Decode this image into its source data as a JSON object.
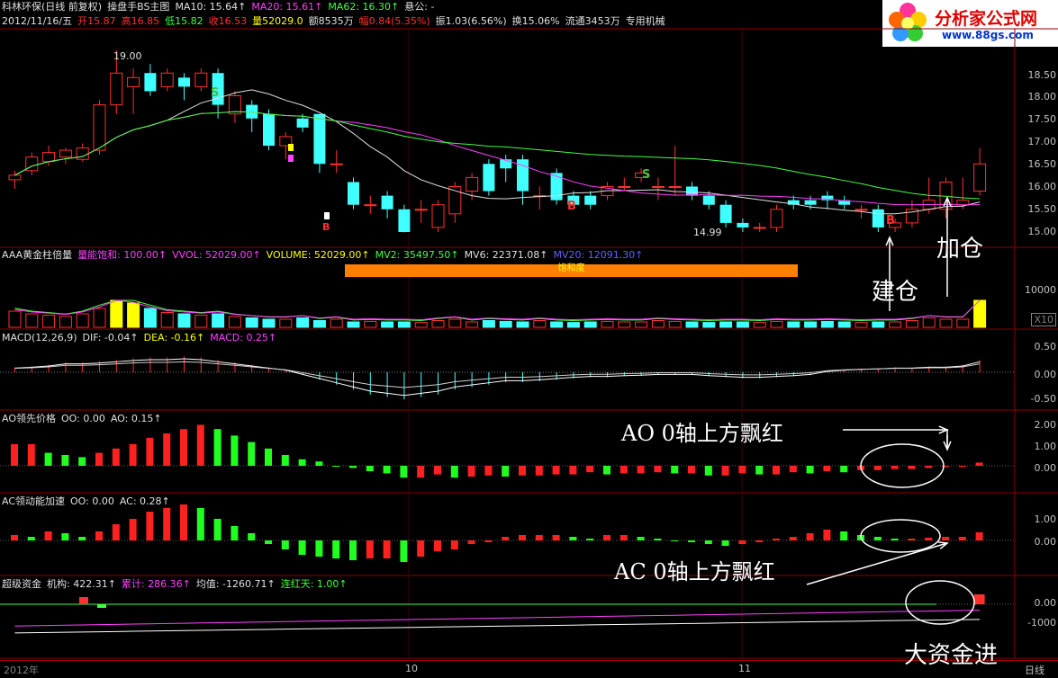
{
  "title_bar": {
    "stock": "科林环保(日线 前复权)",
    "indicator": "操盘手BS主图",
    "ma10": "MA10: 15.64↑",
    "ma20": "MA20: 15.61↑",
    "ma62": "MA62: 16.30↑",
    "flag": "悬公: -"
  },
  "quote_bar": {
    "date": "2012/11/16/五",
    "open": "开15.87",
    "high": "高16.85",
    "low": "低15.82",
    "close": "收16.53",
    "vol": "量52029.0",
    "amount": "额8535万",
    "change": "幅0.84(5.35%)",
    "amplitude": "振1.03(6.56%)",
    "turnover": "换15.06%",
    "float": "流通3453万",
    "industry": "专用机械"
  },
  "logo": {
    "text": "分析家公式网",
    "url": "www.88gs.com"
  },
  "price_axis": [
    "18.50",
    "18.00",
    "17.50",
    "17.00",
    "16.50",
    "16.00",
    "15.50",
    "15.00"
  ],
  "price_labels": {
    "high": "19.00",
    "low": "14.99",
    "s1": "S",
    "s2": "S",
    "b1": "B",
    "b2": "B",
    "b3": "B"
  },
  "vol_panel": {
    "name": "AAA黄金柱倍量",
    "sat": "量能饱和: 100.00↑",
    "vvol": "VVOL: 52029.00↑",
    "volume": "VOLUME: 52029.00↑",
    "mv2": "MV2: 35497.50↑",
    "mv6": "MV6: 22371.08↑",
    "mv20": "MV20: 12091.30↑",
    "bar_label": "饱和度",
    "axis": "10000",
    "unit": "X10"
  },
  "macd_panel": {
    "name": "MACD(12,26,9)",
    "dif": "DIF: -0.04↑",
    "dea": "DEA: -0.16↑",
    "macd": "MACD: 0.25↑",
    "axis": [
      "0.50",
      "0.00",
      "-0.50"
    ]
  },
  "ao_panel": {
    "name": "AO领先价格",
    "oo": "OO: 0.00",
    "ao": "AO: 0.15↑",
    "axis": [
      "2.00",
      "1.00",
      "0.00"
    ]
  },
  "ac_panel": {
    "name": "AC领动能加速",
    "oo": "OO: 0.00",
    "ac": "AC: 0.28↑",
    "axis": [
      "1.00",
      "0.00"
    ]
  },
  "fund_panel": {
    "name": "超级资金",
    "inst": "机构: 422.31↑",
    "cum": "累计: 286.36↑",
    "avg": "均值: -1260.71↑",
    "red": "连红天: 1.00↑",
    "axis": [
      "0.00",
      "-1000"
    ]
  },
  "time_axis": {
    "y": "2012年",
    "m10": "10",
    "m11": "11",
    "period": "日线"
  },
  "annotations": {
    "jiancang": "建仓",
    "jiacang": "加仓",
    "ao_note": "AO 0轴上方飘红",
    "ac_note": "AC 0轴上方飘红",
    "big_money": "大资金进"
  },
  "colors": {
    "up": "#ff3030",
    "down": "#40ffff",
    "green": "#40ff40",
    "magenta": "#ff40ff",
    "orange": "#ff8000"
  },
  "candles": [
    [
      16.15,
      16.25,
      15.95,
      16.35
    ],
    [
      16.35,
      16.65,
      16.25,
      16.75
    ],
    [
      16.55,
      16.75,
      16.45,
      16.9
    ],
    [
      16.65,
      16.8,
      16.5,
      16.85
    ],
    [
      16.6,
      16.85,
      16.55,
      16.95
    ],
    [
      16.8,
      17.8,
      16.7,
      17.9
    ],
    [
      17.8,
      18.5,
      17.6,
      19.0
    ],
    [
      18.2,
      18.4,
      17.6,
      18.6
    ],
    [
      18.5,
      18.1,
      18.0,
      18.7
    ],
    [
      18.2,
      18.5,
      18.1,
      18.6
    ],
    [
      18.4,
      18.2,
      17.9,
      18.5
    ],
    [
      18.2,
      18.5,
      18.1,
      18.6
    ],
    [
      18.5,
      17.8,
      17.5,
      18.6
    ],
    [
      17.6,
      18.0,
      17.4,
      18.1
    ],
    [
      17.8,
      17.5,
      17.2,
      17.9
    ],
    [
      17.6,
      16.9,
      16.8,
      17.7
    ],
    [
      16.9,
      17.1,
      16.6,
      17.2
    ],
    [
      17.5,
      17.3,
      17.2,
      17.6
    ],
    [
      17.6,
      16.5,
      16.3,
      17.6
    ],
    [
      16.5,
      16.5,
      16.3,
      16.8
    ],
    [
      16.1,
      15.6,
      15.5,
      16.2
    ],
    [
      15.6,
      15.6,
      15.4,
      15.8
    ],
    [
      15.8,
      15.5,
      15.3,
      15.9
    ],
    [
      15.5,
      15.0,
      14.99,
      15.6
    ],
    [
      15.5,
      15.5,
      15.2,
      15.7
    ],
    [
      15.1,
      15.6,
      15.0,
      15.7
    ],
    [
      15.4,
      16.0,
      15.2,
      16.1
    ],
    [
      15.9,
      16.2,
      15.7,
      16.3
    ],
    [
      16.5,
      15.9,
      15.8,
      16.6
    ],
    [
      16.6,
      16.4,
      16.1,
      16.7
    ],
    [
      16.6,
      15.9,
      15.6,
      16.7
    ],
    [
      15.8,
      15.8,
      15.5,
      16.0
    ],
    [
      16.3,
      15.7,
      15.6,
      16.4
    ],
    [
      15.8,
      15.6,
      15.5,
      15.9
    ],
    [
      15.8,
      15.6,
      15.5,
      15.9
    ],
    [
      15.8,
      16.0,
      15.7,
      16.1
    ],
    [
      16.0,
      16.0,
      15.9,
      16.2
    ],
    [
      16.2,
      16.3,
      16.1,
      16.4
    ],
    [
      16.0,
      16.0,
      15.7,
      16.2
    ],
    [
      16.0,
      16.0,
      15.8,
      16.9
    ],
    [
      16.0,
      15.8,
      15.7,
      16.1
    ],
    [
      15.8,
      15.6,
      15.5,
      15.9
    ],
    [
      15.6,
      15.2,
      15.1,
      15.7
    ],
    [
      15.2,
      15.1,
      15.0,
      15.3
    ],
    [
      15.1,
      15.1,
      15.0,
      15.2
    ],
    [
      15.1,
      15.5,
      15.0,
      15.6
    ],
    [
      15.7,
      15.6,
      15.5,
      15.8
    ],
    [
      15.7,
      15.6,
      15.5,
      15.8
    ],
    [
      15.8,
      15.7,
      15.5,
      15.9
    ],
    [
      15.7,
      15.6,
      15.5,
      15.8
    ],
    [
      15.5,
      15.5,
      15.3,
      15.6
    ],
    [
      15.5,
      15.1,
      15.0,
      15.6
    ],
    [
      15.1,
      15.2,
      15.0,
      15.3
    ],
    [
      15.2,
      15.5,
      15.1,
      15.7
    ],
    [
      15.5,
      15.7,
      15.4,
      16.2
    ],
    [
      15.5,
      16.1,
      15.3,
      16.2
    ],
    [
      15.6,
      15.7,
      15.5,
      16.2
    ],
    [
      15.9,
      16.5,
      15.8,
      16.85
    ]
  ],
  "ao_values": [
    1.0,
    1.0,
    0.6,
    0.5,
    0.4,
    0.6,
    0.8,
    1.0,
    1.3,
    1.5,
    1.7,
    1.9,
    1.7,
    1.4,
    1.1,
    0.8,
    0.5,
    0.3,
    0.2,
    0.0,
    -0.1,
    -0.25,
    -0.35,
    -0.55,
    -0.55,
    -0.4,
    -0.55,
    -0.5,
    -0.45,
    -0.5,
    -0.45,
    -0.45,
    -0.4,
    -0.4,
    -0.3,
    -0.4,
    -0.35,
    -0.35,
    -0.3,
    -0.35,
    -0.35,
    -0.45,
    -0.45,
    -0.35,
    -0.4,
    -0.4,
    -0.3,
    -0.35,
    -0.25,
    -0.3,
    -0.2,
    -0.2,
    -0.15,
    -0.15,
    -0.1,
    -0.05,
    -0.05,
    0.15
  ],
  "ac_values": [
    0.3,
    0.2,
    0.5,
    0.4,
    0.2,
    0.5,
    0.9,
    1.2,
    1.6,
    1.8,
    2.0,
    1.8,
    1.2,
    0.8,
    0.4,
    -0.2,
    -0.5,
    -0.8,
    -0.9,
    -1.0,
    -1.1,
    -1.0,
    -1.0,
    -1.2,
    -0.9,
    -0.6,
    -0.5,
    -0.2,
    -0.1,
    0.2,
    0.3,
    0.3,
    0.3,
    0.2,
    0.1,
    0.3,
    0.3,
    0.2,
    0.1,
    0.0,
    -0.1,
    -0.2,
    -0.3,
    -0.2,
    -0.1,
    0.1,
    0.2,
    0.4,
    0.6,
    0.5,
    0.3,
    0.2,
    0.1,
    0.1,
    0.15,
    0.2,
    0.2,
    0.45
  ],
  "macd_values": [
    0.1,
    0.12,
    0.15,
    0.2,
    0.2,
    0.22,
    0.25,
    0.28,
    0.3,
    0.3,
    0.32,
    0.3,
    0.25,
    0.2,
    0.15,
    0.1,
    0.05,
    -0.05,
    -0.15,
    -0.25,
    -0.35,
    -0.45,
    -0.5,
    -0.55,
    -0.5,
    -0.45,
    -0.35,
    -0.3,
    -0.25,
    -0.2,
    -0.2,
    -0.18,
    -0.15,
    -0.12,
    -0.1,
    -0.1,
    -0.08,
    -0.07,
    -0.05,
    -0.05,
    -0.05,
    -0.08,
    -0.1,
    -0.12,
    -0.12,
    -0.1,
    -0.08,
    -0.05,
    0.02,
    0.05,
    0.07,
    0.08,
    0.1,
    0.1,
    0.12,
    0.12,
    0.15,
    0.25
  ],
  "vol_values": [
    0.6,
    0.5,
    0.45,
    0.4,
    0.5,
    0.7,
    1.0,
    0.9,
    0.7,
    0.55,
    0.5,
    0.45,
    0.5,
    0.4,
    0.35,
    0.3,
    0.3,
    0.35,
    0.25,
    0.3,
    0.2,
    0.22,
    0.2,
    0.2,
    0.18,
    0.25,
    0.3,
    0.2,
    0.25,
    0.22,
    0.2,
    0.25,
    0.2,
    0.18,
    0.2,
    0.22,
    0.2,
    0.2,
    0.25,
    0.22,
    0.2,
    0.18,
    0.2,
    0.2,
    0.18,
    0.22,
    0.2,
    0.2,
    0.22,
    0.2,
    0.18,
    0.2,
    0.2,
    0.25,
    0.35,
    0.3,
    0.3,
    1.0
  ]
}
